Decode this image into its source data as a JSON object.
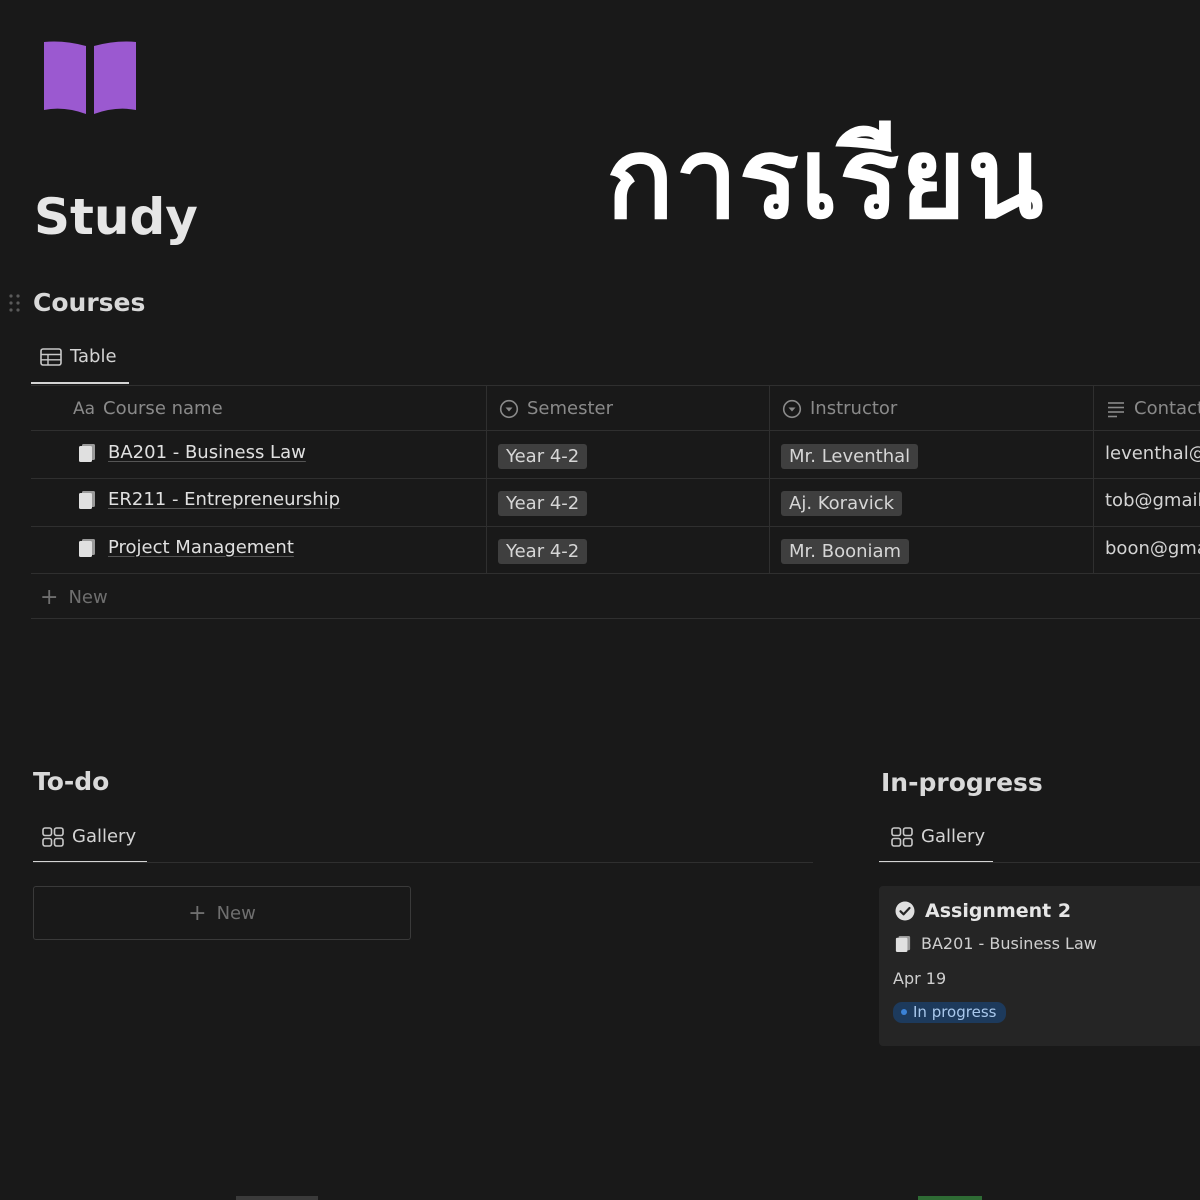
{
  "page": {
    "title": "Study",
    "overlay_title": "การเรียน",
    "icon": "book-icon",
    "accent_color": "#9b59d0"
  },
  "courses": {
    "title": "Courses",
    "view_tab": "Table",
    "columns": [
      {
        "label": "Course name",
        "icon": "aa"
      },
      {
        "label": "Semester",
        "icon": "select-icon"
      },
      {
        "label": "Instructor",
        "icon": "select-icon"
      },
      {
        "label": "Contact",
        "icon": "text-icon"
      }
    ],
    "rows": [
      {
        "name": "BA201 - Business Law",
        "semester": "Year 4-2",
        "instructor": "Mr. Leventhal",
        "contact": "leventhal@"
      },
      {
        "name": "ER211 - Entrepreneurship",
        "semester": "Year 4-2",
        "instructor": "Aj. Koravick",
        "contact": "tob@gmail"
      },
      {
        "name": "Project Management",
        "semester": "Year 4-2",
        "instructor": "Mr. Booniam",
        "contact": "boon@gma"
      }
    ],
    "new_label": "New"
  },
  "todo": {
    "title": "To-do",
    "view_tab": "Gallery",
    "new_label": "New"
  },
  "in_progress": {
    "title": "In-progress",
    "view_tab": "Gallery",
    "card": {
      "title": "Assignment 2",
      "course": "BA201 - Business Law",
      "date": "Apr 19",
      "status": "In progress",
      "status_color": "#3b82d6"
    }
  }
}
